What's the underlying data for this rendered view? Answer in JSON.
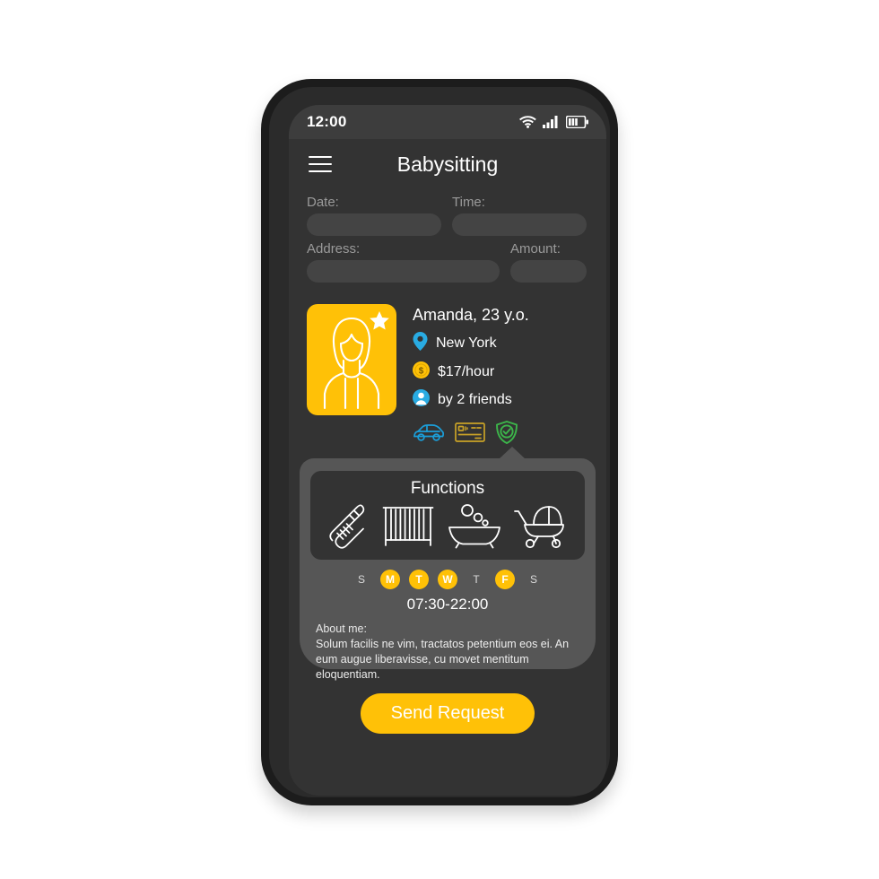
{
  "status_bar": {
    "time": "12:00",
    "icons": [
      "wifi-icon",
      "cellular-signal-icon",
      "battery-icon"
    ]
  },
  "header": {
    "menu_icon": "hamburger-menu-icon",
    "title": "Babysitting"
  },
  "form": {
    "fields": [
      {
        "label": "Date:",
        "value": "",
        "placeholder": ""
      },
      {
        "label": "Time:",
        "value": "",
        "placeholder": ""
      },
      {
        "label": "Address:",
        "value": "",
        "placeholder": ""
      },
      {
        "label": "Amount:",
        "value": "",
        "placeholder": ""
      }
    ]
  },
  "profile": {
    "avatar_icon": "woman-avatar-icon",
    "star_badge_icon": "star-icon",
    "name": "Amanda, 23 y.o.",
    "location_icon": "location-pin-icon",
    "location": "New York",
    "rate_icon": "coin-dollar-icon",
    "rate": "$17/hour",
    "friends_icon": "person-icon",
    "friends": "by 2 friends",
    "badges": [
      {
        "icon": "car-icon",
        "color": "#1B9ED9"
      },
      {
        "icon": "credit-card-icon",
        "color": "#C9A227"
      },
      {
        "icon": "shield-check-icon",
        "color": "#3CB54A"
      }
    ]
  },
  "functions": {
    "title": "Functions",
    "items": [
      {
        "icon": "baby-bottle-icon"
      },
      {
        "icon": "crib-icon"
      },
      {
        "icon": "bathtub-icon"
      },
      {
        "icon": "stroller-icon"
      }
    ]
  },
  "schedule": {
    "days": [
      {
        "label": "S",
        "active": false
      },
      {
        "label": "M",
        "active": true
      },
      {
        "label": "T",
        "active": true
      },
      {
        "label": "W",
        "active": true
      },
      {
        "label": "T",
        "active": false
      },
      {
        "label": "F",
        "active": true
      },
      {
        "label": "S",
        "active": false
      }
    ],
    "hours": "07:30-22:00"
  },
  "about": {
    "label": "About me:",
    "text": "Solum facilis ne vim, tractatos petentium eos ei. An eum augue liberavisse, cu movet mentitum eloquentiam."
  },
  "actions": {
    "send_label": "Send Request"
  },
  "colors": {
    "accent": "#FFC107",
    "screen_bg": "#333333",
    "card_bg": "#565656",
    "input_bg": "#444444",
    "status_bar_bg": "#3D3D3D"
  }
}
